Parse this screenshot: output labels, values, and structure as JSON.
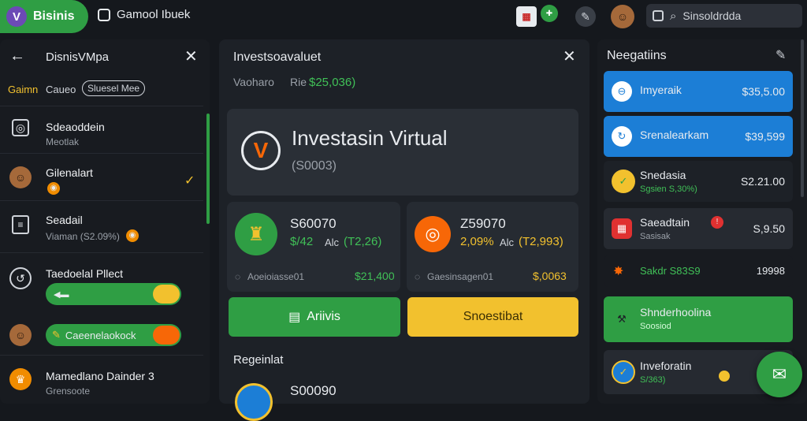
{
  "topbar": {
    "brand_logo": "V",
    "brand_name": "Bisinis",
    "window_title": "Gamool Ibuek",
    "icons": [
      "calendar-icon",
      "badge-icon",
      "settings-icon",
      "avatar"
    ],
    "search_text": "Sinsoldrdda"
  },
  "left": {
    "back_title": "DisnisVMpa",
    "tabs": [
      "Gaimn",
      "Caueo",
      "Sluesel Mee"
    ],
    "items": [
      {
        "title": "Sdeaoddein",
        "sub": "Meotlak"
      },
      {
        "title": "Gilenalart",
        "sub": ""
      },
      {
        "title": "Seadail",
        "sub": "Viaman (S2.09%)"
      },
      {
        "title": "Taedoelal Pllect",
        "sub": ""
      },
      {
        "title": "Caeenelaokock",
        "sub": ""
      },
      {
        "title": "Mamedlano Dainder 3",
        "sub": "Grensoote"
      }
    ]
  },
  "mid": {
    "title": "Investsoavaluet",
    "sub_label": "Vaoharo",
    "sub_prefix": "Rie",
    "sub_value": "$25,036)",
    "hero_title": "Investasin Virtual",
    "hero_value": "(S0003)",
    "cards": [
      {
        "value": "S60070",
        "pct": "$/42",
        "pair_label": "Alc",
        "pair_value": "(T2,26)",
        "foot_label": "Aoeioiasse01",
        "foot_value": "$21,400"
      },
      {
        "value": "Z59070",
        "pct": "2,09%",
        "pair_label": "Alc",
        "pair_value": "(T2,993)",
        "foot_label": "Gaesinsagen01",
        "foot_value": "$,0063"
      }
    ],
    "btn_green": "Ariivis",
    "btn_yellow": "Snoestibat",
    "section": "Regeinlat",
    "bottom_value": "S00090"
  },
  "right": {
    "title": "Neegatiins",
    "cards": [
      {
        "title": "Imyeraik",
        "sub": "",
        "value": "$35,5.00"
      },
      {
        "title": "Srenalearkam",
        "sub": "",
        "value": "$39,599"
      },
      {
        "title": "Snedasia",
        "sub": "Sgsien S,30%)",
        "value": "S2.21.00"
      },
      {
        "title": "Saeadtain",
        "sub": "Sasisak",
        "value": "S,9.50"
      },
      {
        "title": "Sakdr S83S9",
        "sub": "",
        "value": "19998"
      },
      {
        "title": "Shnderhoolina",
        "sub": "Soosiod",
        "value": ""
      },
      {
        "title": "Inveforatin",
        "sub": "S/363)",
        "value": ""
      }
    ]
  },
  "colors": {
    "green": "#2f9e44",
    "blue": "#1c7ed6",
    "yellow": "#f2c12e",
    "orange": "#f76707",
    "red": "#e03131",
    "accent_green_text": "#40c057"
  }
}
